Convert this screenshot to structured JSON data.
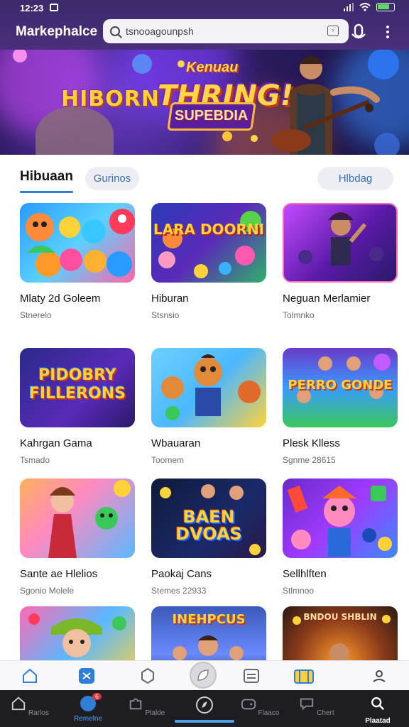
{
  "status": {
    "time": "12:23"
  },
  "header": {
    "title": "Markephalce",
    "search_value": "tsnooagounpsh"
  },
  "banner": {
    "line_small": "Kenuau",
    "line_left": "HIBORN",
    "line_big": "THRING!",
    "line_plate": "SUPEBDIA"
  },
  "tabs": {
    "active": "Hibuaan",
    "pill_left": "Gurinos",
    "pill_right": "Hlbdag"
  },
  "games": [
    {
      "name": "Mlaty 2d Goleem",
      "sub": "Stnerelo"
    },
    {
      "name": "Hiburan",
      "sub": "Stsnsio",
      "art": "LARA DOORNI"
    },
    {
      "name": "Neguan Merlamier",
      "sub": "Tolmnko"
    },
    {
      "name": "Kahrgan Gama",
      "sub": "Tsmado",
      "art": "PIDOBRY FILLERONS"
    },
    {
      "name": "Wbauaran",
      "sub": "Toomem"
    },
    {
      "name": "Plesk Klless",
      "sub": "Sgnme 28615",
      "art": "PERRO GONDE"
    },
    {
      "name": "Sante ae Hlelios",
      "sub": "Sgonio Molele"
    },
    {
      "name": "Paokaj Cans",
      "sub": "Stemes 22933",
      "art": "BAEN DVOAS"
    },
    {
      "name": "Sellhlften",
      "sub": "Stlmnoo"
    },
    {
      "name": "",
      "sub": ""
    },
    {
      "name": "",
      "sub": "",
      "art": "INEHPCUS"
    },
    {
      "name": "",
      "sub": "",
      "art": "BNDOU SHBLIN"
    }
  ],
  "nav": [
    {
      "label": "Rarlos",
      "icon": "home-icon"
    },
    {
      "label": "Remelne",
      "icon": "chat-icon"
    },
    {
      "label": "Plalde",
      "icon": "puzzle-icon"
    },
    {
      "label": "",
      "icon": "compass-icon"
    },
    {
      "label": "Flaaco",
      "icon": "game-icon"
    },
    {
      "label": "Chert",
      "icon": "bubble-icon"
    },
    {
      "label": "Plaatad",
      "icon": "search-icon"
    }
  ],
  "nav_badge": "6",
  "colors": {
    "accent": "#2f7fd6",
    "header": "#3b2a6c",
    "navbar": "#1e1e22"
  }
}
